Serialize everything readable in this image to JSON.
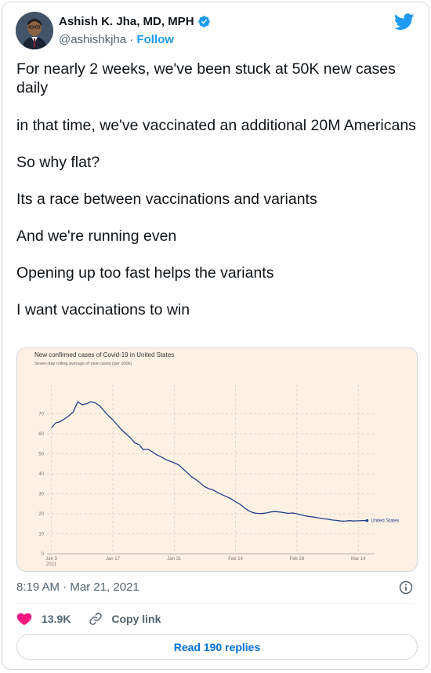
{
  "author": {
    "name": "Ashish K. Jha, MD, MPH",
    "handle": "@ashishkjha",
    "separator": "·",
    "follow_label": "Follow"
  },
  "tweet": {
    "paragraphs": [
      "For nearly 2 weeks, we've been stuck at 50K new cases daily",
      "in that time, we've vaccinated an additional 20M Americans",
      "So why flat?",
      "Its a race between vaccinations and variants",
      "And we're running even",
      "Opening up too fast helps the variants",
      "I want vaccinations to win"
    ]
  },
  "chart_data": {
    "type": "line",
    "title": "New confirmed cases of Covid-19 in United States",
    "subtitle": "Seven-day rolling average of new cases (per 100k)",
    "xlabel": "",
    "ylabel": "",
    "x_ticks": [
      {
        "day": 0,
        "label": "Jan 3",
        "sublabel": "2021"
      },
      {
        "day": 14,
        "label": "Jan 17"
      },
      {
        "day": 28,
        "label": "Jan 31"
      },
      {
        "day": 42,
        "label": "Feb 14"
      },
      {
        "day": 56,
        "label": "Feb 28"
      },
      {
        "day": 70,
        "label": "Mar 14"
      }
    ],
    "y_ticks": [
      0,
      10,
      20,
      30,
      40,
      50,
      60,
      70
    ],
    "xlim": [
      -1,
      73
    ],
    "ylim": [
      0,
      80
    ],
    "grid": true,
    "series": [
      {
        "name": "United States",
        "color": "#1f3f8f",
        "points": [
          [
            0,
            63
          ],
          [
            1,
            65.5
          ],
          [
            2,
            66
          ],
          [
            3,
            67.5
          ],
          [
            4,
            69
          ],
          [
            5,
            71
          ],
          [
            6,
            76
          ],
          [
            7,
            74.5
          ],
          [
            8,
            75
          ],
          [
            9,
            76
          ],
          [
            10,
            75.5
          ],
          [
            11,
            74
          ],
          [
            12,
            71.5
          ],
          [
            13,
            69
          ],
          [
            14,
            67
          ],
          [
            15,
            64.5
          ],
          [
            16,
            62
          ],
          [
            17,
            60
          ],
          [
            18,
            58
          ],
          [
            19,
            55.5
          ],
          [
            20,
            54.5
          ],
          [
            21,
            52
          ],
          [
            22,
            52.3
          ],
          [
            23,
            51
          ],
          [
            24,
            49.5
          ],
          [
            25,
            48.5
          ],
          [
            26,
            47.2
          ],
          [
            27,
            46.3
          ],
          [
            28,
            45.5
          ],
          [
            29,
            44.5
          ],
          [
            30,
            42.5
          ],
          [
            31,
            40.5
          ],
          [
            32,
            38.5
          ],
          [
            33,
            37
          ],
          [
            34,
            35.3
          ],
          [
            35,
            33.5
          ],
          [
            36,
            32.5
          ],
          [
            37,
            31.8
          ],
          [
            38,
            30.5
          ],
          [
            39,
            29.5
          ],
          [
            40,
            28.5
          ],
          [
            41,
            27.5
          ],
          [
            42,
            26
          ],
          [
            43,
            24.8
          ],
          [
            44,
            23
          ],
          [
            45,
            21.5
          ],
          [
            46,
            20.5
          ],
          [
            47,
            20.2
          ],
          [
            48,
            20.1
          ],
          [
            49,
            20.4
          ],
          [
            50,
            20.9
          ],
          [
            51,
            21.1
          ],
          [
            52,
            20.9
          ],
          [
            53,
            20.6
          ],
          [
            54,
            20.2
          ],
          [
            55,
            20.4
          ],
          [
            56,
            20
          ],
          [
            57,
            19.4
          ],
          [
            58,
            18.9
          ],
          [
            59,
            18.6
          ],
          [
            60,
            18.3
          ],
          [
            61,
            17.9
          ],
          [
            62,
            17.5
          ],
          [
            63,
            17.3
          ],
          [
            64,
            16.9
          ],
          [
            65,
            16.7
          ],
          [
            66,
            16.4
          ],
          [
            67,
            16.3
          ],
          [
            68,
            16.6
          ],
          [
            69,
            16.4
          ],
          [
            70,
            16.5
          ],
          [
            71,
            16.6
          ],
          [
            72,
            16.6
          ]
        ]
      }
    ]
  },
  "meta": {
    "timestamp": "8:19 AM · Mar 21, 2021"
  },
  "actions": {
    "like_count": "13.9K",
    "copy_link_label": "Copy link",
    "read_replies_label": "Read 190 replies"
  },
  "colors": {
    "accent": "#1d9bf0",
    "like": "#f91880",
    "chart_bg": "#fdf1e3",
    "series": "#1f3f8f"
  }
}
